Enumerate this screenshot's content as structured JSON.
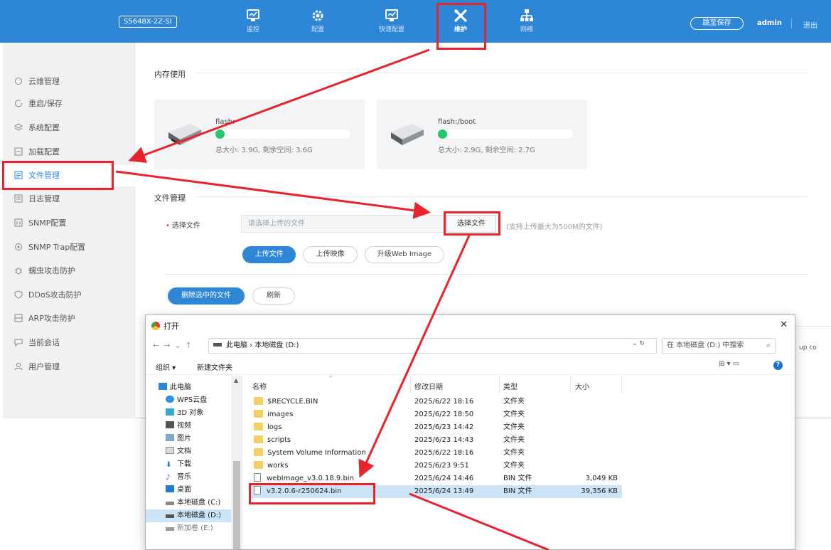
{
  "header": {
    "model": "S5648X-2Z-SI",
    "nav": [
      {
        "label": "监控",
        "icon": "monitor-icon"
      },
      {
        "label": "配置",
        "icon": "gear-icon"
      },
      {
        "label": "快速配置",
        "icon": "monitor-icon"
      },
      {
        "label": "维护",
        "icon": "wrench-icon"
      },
      {
        "label": "网络",
        "icon": "network-icon"
      }
    ],
    "save_label": "跳至保存",
    "user": "admin",
    "logout": "退出"
  },
  "sidebar": {
    "items": [
      {
        "label": "云维管理",
        "icon": "cloud-icon"
      },
      {
        "label": "重启/保存",
        "icon": "restart-icon"
      },
      {
        "label": "系统配置",
        "icon": "layers-icon"
      },
      {
        "label": "加载配置",
        "icon": "load-icon"
      },
      {
        "label": "文件管理",
        "icon": "file-icon"
      },
      {
        "label": "日志管理",
        "icon": "log-icon"
      },
      {
        "label": "SNMP配置",
        "icon": "snmp-icon"
      },
      {
        "label": "SNMP Trap配置",
        "icon": "trap-icon"
      },
      {
        "label": "蠕虫攻击防护",
        "icon": "bug-icon"
      },
      {
        "label": "DDoS攻击防护",
        "icon": "shield-icon"
      },
      {
        "label": "ARP攻击防护",
        "icon": "arp-icon"
      },
      {
        "label": "当前会话",
        "icon": "chat-icon"
      },
      {
        "label": "用户管理",
        "icon": "user-icon"
      }
    ]
  },
  "memory": {
    "title": "内存使用",
    "cards": [
      {
        "name": "flash:",
        "info": "总大小: 3.9G, 剩余空间: 3.6G"
      },
      {
        "name": "flash:/boot",
        "info": "总大小: 2.9G, 剩余空间: 2.7G"
      }
    ]
  },
  "files": {
    "title": "文件管理",
    "field_label": "选择文件",
    "input_placeholder": "请选择上传的文件",
    "choose_label": "选择文件",
    "hint": "(支持上传最大为500M的文件)",
    "upload_file": "上传文件",
    "upload_image": "上传映像",
    "upgrade_web": "升级Web Image",
    "delete_selected": "删除选中的文件",
    "refresh": "刷新",
    "peek_text": "up co"
  },
  "dialog": {
    "title": "打开",
    "path": [
      "此电脑",
      "本地磁盘 (D:)"
    ],
    "search_placeholder": "在 本地磁盘 (D:) 中搜索",
    "organize": "组织 ▾",
    "new_folder": "新建文件夹",
    "tree": [
      {
        "label": "此电脑",
        "icon": "computer-icon"
      },
      {
        "label": "WPS云盘",
        "icon": "cloud-icon"
      },
      {
        "label": "3D 对象",
        "icon": "cube-icon"
      },
      {
        "label": "视频",
        "icon": "video-icon"
      },
      {
        "label": "图片",
        "icon": "picture-icon"
      },
      {
        "label": "文档",
        "icon": "document-icon"
      },
      {
        "label": "下载",
        "icon": "download-icon"
      },
      {
        "label": "音乐",
        "icon": "music-icon"
      },
      {
        "label": "桌面",
        "icon": "desktop-icon"
      },
      {
        "label": "本地磁盘 (C:)",
        "icon": "drive-icon"
      },
      {
        "label": "本地磁盘 (D:)",
        "icon": "drive-icon"
      },
      {
        "label": "新加卷 (E:)",
        "icon": "drive-icon"
      }
    ],
    "columns": [
      "名称",
      "修改日期",
      "类型",
      "大小"
    ],
    "rows": [
      {
        "name": "$RECYCLE.BIN",
        "date": "2025/6/22 18:16",
        "type": "文件夹",
        "size": "",
        "kind": "folder"
      },
      {
        "name": "images",
        "date": "2025/6/22 18:50",
        "type": "文件夹",
        "size": "",
        "kind": "folder"
      },
      {
        "name": "logs",
        "date": "2025/6/23 14:42",
        "type": "文件夹",
        "size": "",
        "kind": "folder"
      },
      {
        "name": "scripts",
        "date": "2025/6/23 14:43",
        "type": "文件夹",
        "size": "",
        "kind": "folder"
      },
      {
        "name": "System Volume Information",
        "date": "2025/6/22 18:16",
        "type": "文件夹",
        "size": "",
        "kind": "folder"
      },
      {
        "name": "works",
        "date": "2025/6/23 9:51",
        "type": "文件夹",
        "size": "",
        "kind": "folder"
      },
      {
        "name": "webImage_v3.0.18.9.bin",
        "date": "2025/6/24 14:46",
        "type": "BIN 文件",
        "size": "3,049 KB",
        "kind": "file"
      },
      {
        "name": "v3.2.0.6-r250624.bin",
        "date": "2025/6/24 13:49",
        "type": "BIN 文件",
        "size": "39,356 KB",
        "kind": "file"
      }
    ]
  },
  "colors": {
    "brand": "#2e86d6",
    "highlight": "#e8232c",
    "selection": "#cce4f7"
  }
}
